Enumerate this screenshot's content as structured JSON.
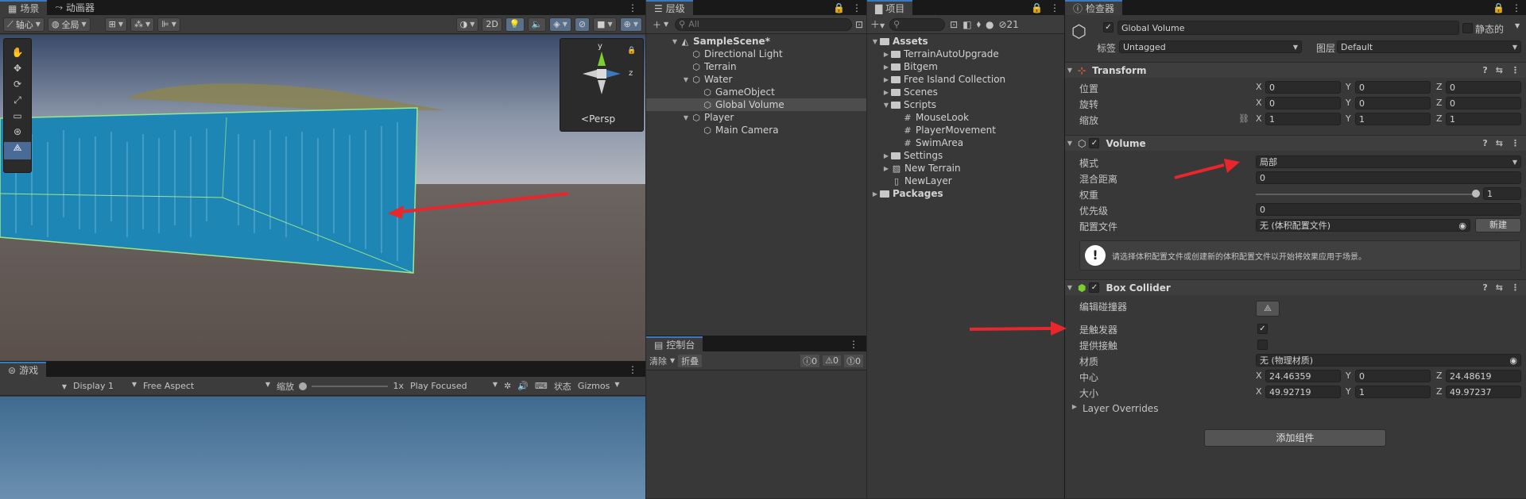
{
  "scene": {
    "tab": "场景",
    "anim_tab": "动画器",
    "pivot": "轴心",
    "global": "全局",
    "mode2d": "2D",
    "persp": "Persp",
    "gizmo_y": "y",
    "gizmo_z": "z"
  },
  "game": {
    "tab": "游戏",
    "display": "Display 1",
    "aspect": "Free Aspect",
    "scale_label": "缩放",
    "scale_value": "1x",
    "play_mode": "Play Focused",
    "stats": "状态",
    "gizmos": "Gizmos"
  },
  "hierarchy": {
    "tab": "层级",
    "search_placeholder": "All",
    "items": [
      {
        "label": "SampleScene*",
        "depth": 0,
        "arrow": "▼",
        "icon": "unity-scene-icon",
        "bold": true
      },
      {
        "label": "Directional Light",
        "depth": 1,
        "arrow": "",
        "icon": "gameobject-icon"
      },
      {
        "label": "Terrain",
        "depth": 1,
        "arrow": "",
        "icon": "gameobject-icon"
      },
      {
        "label": "Water",
        "depth": 1,
        "arrow": "▼",
        "icon": "gameobject-icon"
      },
      {
        "label": "GameObject",
        "depth": 2,
        "arrow": "",
        "icon": "gameobject-icon"
      },
      {
        "label": "Global Volume",
        "depth": 2,
        "arrow": "",
        "icon": "gameobject-icon",
        "selected": true
      },
      {
        "label": "Player",
        "depth": 1,
        "arrow": "▼",
        "icon": "gameobject-icon"
      },
      {
        "label": "Main Camera",
        "depth": 2,
        "arrow": "",
        "icon": "gameobject-icon"
      }
    ]
  },
  "console": {
    "tab": "控制台",
    "clear": "清除",
    "collapse": "折叠",
    "count_info": "0",
    "count_warn": "0",
    "count_error": "0"
  },
  "project": {
    "tab": "项目",
    "hidden_count": "21",
    "items": [
      {
        "label": "Assets",
        "depth": 0,
        "arrow": "▼",
        "type": "folder",
        "bold": true
      },
      {
        "label": "TerrainAutoUpgrade",
        "depth": 1,
        "arrow": "▶",
        "type": "folder"
      },
      {
        "label": "Bitgem",
        "depth": 1,
        "arrow": "▶",
        "type": "folder"
      },
      {
        "label": "Free Island Collection",
        "depth": 1,
        "arrow": "▶",
        "type": "folder"
      },
      {
        "label": "Scenes",
        "depth": 1,
        "arrow": "▶",
        "type": "folder"
      },
      {
        "label": "Scripts",
        "depth": 1,
        "arrow": "▼",
        "type": "folder"
      },
      {
        "label": "MouseLook",
        "depth": 2,
        "arrow": "",
        "type": "script"
      },
      {
        "label": "PlayerMovement",
        "depth": 2,
        "arrow": "",
        "type": "script"
      },
      {
        "label": "SwimArea",
        "depth": 2,
        "arrow": "",
        "type": "script"
      },
      {
        "label": "Settings",
        "depth": 1,
        "arrow": "▶",
        "type": "folder"
      },
      {
        "label": "New Terrain",
        "depth": 1,
        "arrow": "▶",
        "type": "terrain"
      },
      {
        "label": "NewLayer",
        "depth": 1,
        "arrow": "",
        "type": "file"
      },
      {
        "label": "Packages",
        "depth": 0,
        "arrow": "▶",
        "type": "folder",
        "bold": true
      }
    ]
  },
  "inspector": {
    "tab": "检查器",
    "object_name": "Global Volume",
    "static_label": "静态的",
    "tag_label": "标签",
    "tag_value": "Untagged",
    "layer_label": "图层",
    "layer_value": "Default",
    "transform": {
      "title": "Transform",
      "position_label": "位置",
      "rotation_label": "旋转",
      "scale_label": "缩放",
      "position": {
        "x": "0",
        "y": "0",
        "z": "0"
      },
      "rotation": {
        "x": "0",
        "y": "0",
        "z": "0"
      },
      "scale": {
        "x": "1",
        "y": "1",
        "z": "1"
      }
    },
    "volume": {
      "title": "Volume",
      "mode_label": "模式",
      "mode_value": "局部",
      "blend_label": "混合距离",
      "blend_value": "0",
      "weight_label": "权重",
      "weight_value": "1",
      "weight_fraction": 1.0,
      "priority_label": "优先级",
      "priority_value": "0",
      "profile_label": "配置文件",
      "profile_value": "无 (体积配置文件)",
      "new_button": "新建",
      "info_text": "请选择体积配置文件或创建新的体积配置文件以开始将效果应用于场景。"
    },
    "box_collider": {
      "title": "Box Collider",
      "edit_label": "编辑碰撞器",
      "trigger_label": "是触发器",
      "provides_contacts_label": "提供接触",
      "material_label": "材质",
      "material_value": "无 (物理材质)",
      "center_label": "中心",
      "size_label": "大小",
      "center": {
        "x": "24.46359",
        "y": "0",
        "z": "24.48619"
      },
      "size": {
        "x": "49.92719",
        "y": "1",
        "z": "49.97237"
      }
    },
    "layer_overrides": "Layer Overrides",
    "add_component": "添加组件"
  },
  "axis": {
    "x": "X",
    "y": "Y",
    "z": "Z"
  },
  "colors": {
    "accent": "#3a79bb",
    "selection": "#4d4d4d",
    "arrow_red": "#e8262b",
    "water": "#1f7fb0"
  }
}
